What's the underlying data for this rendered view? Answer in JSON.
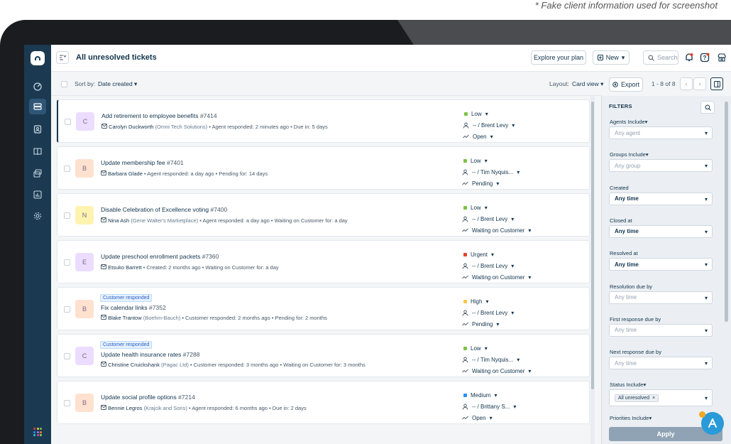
{
  "caption": "* Fake client information used for screenshot",
  "header": {
    "title": "All unresolved tickets",
    "explore_label": "Explore your plan",
    "new_label": "New",
    "search_placeholder": "Search"
  },
  "toolbar": {
    "sort_label": "Sort by:",
    "sort_value": "Date created",
    "layout_label": "Layout:",
    "layout_value": "Card view",
    "export_label": "Export",
    "pagination": "1 - 8 of 8"
  },
  "tickets": [
    {
      "initial": "C",
      "tag": "",
      "subject": "Add retirement to employee benefits",
      "number": "#7414",
      "requester": "Carolyn Duckworth",
      "company": "(Omni Tech Solutions)",
      "detail": "• Agent responded: 2 minutes ago • Due in: 5 days",
      "priority": "Low",
      "assignee": "-- / Brent Levy",
      "status": "Open"
    },
    {
      "initial": "B",
      "tag": "",
      "subject": "Update membership fee",
      "number": "#7401",
      "requester": "Barbara Glade",
      "company": "",
      "detail": "• Agent responded: a day ago • Pending for: 14 days",
      "priority": "Low",
      "assignee": "-- / Tim Nyquis...",
      "status": "Pending"
    },
    {
      "initial": "N",
      "tag": "",
      "subject": "Disable Celebration of Excellence voting",
      "number": "#7400",
      "requester": "Nina Ash",
      "company": "(Gene Walter's Marketplace)",
      "detail": "• Agent responded: a day ago • Waiting on Customer for: a day",
      "priority": "Low",
      "assignee": "-- / Brent Levy",
      "status": "Waiting on Customer"
    },
    {
      "initial": "E",
      "tag": "",
      "subject": "Update preschool enrollment packets",
      "number": "#7360",
      "requester": "Etsuko Barrett",
      "company": "",
      "detail": "• Created: 2 months ago • Waiting on Customer for: a day",
      "priority": "Urgent",
      "assignee": "-- / Brent Levy",
      "status": "Waiting on Customer"
    },
    {
      "initial": "B",
      "tag": "Customer responded",
      "subject": "Fix calendar links",
      "number": "#7352",
      "requester": "Blake Trantow",
      "company": "(Boehm-Bauch)",
      "detail": "• Customer responded: 2 months ago • Pending for: 2 months",
      "priority": "High",
      "assignee": "-- / Brent Levy",
      "status": "Pending"
    },
    {
      "initial": "C",
      "tag": "Customer responded",
      "subject": "Update health insurance rates",
      "number": "#7288",
      "requester": "Christine Cruickshank",
      "company": "(Pagac Ltd)",
      "detail": "• Customer responded: 3 months ago • Waiting on Customer for: 3 months",
      "priority": "Low",
      "assignee": "-- / Tim Nyquis...",
      "status": "Waiting on Customer"
    },
    {
      "initial": "B",
      "tag": "",
      "subject": "Update social profile options",
      "number": "#7214",
      "requester": "Bennie Legros",
      "company": "(Krajcik and Sons)",
      "detail": "• Agent responded: 6 months ago • Due in: 2 days",
      "priority": "Medium",
      "assignee": "-- / Brittany S...",
      "status": "Open"
    }
  ],
  "filters": {
    "title": "FILTERS",
    "items": [
      {
        "label": "Agents Include",
        "value": "Any agent"
      },
      {
        "label": "Groups Include",
        "value": "Any group"
      },
      {
        "label": "Created",
        "value": "Any time"
      },
      {
        "label": "Closed at",
        "value": "Any time"
      },
      {
        "label": "Resolved at",
        "value": "Any time"
      },
      {
        "label": "Resolution due by",
        "value": "Any time"
      },
      {
        "label": "First response due by",
        "value": "Any time"
      },
      {
        "label": "Next response due by",
        "value": "Any time"
      },
      {
        "label": "Status Include",
        "value": "All unresolved"
      },
      {
        "label": "Priorities Include",
        "value": ""
      }
    ],
    "apply_label": "Apply"
  },
  "colors": {
    "nav_bg": "#1b3a52",
    "avatar_C": "#ecdcff",
    "avatar_B": "#ffe1cf",
    "avatar_N": "#fff3b0",
    "avatar_E": "#ecdcff",
    "priority_low": "#7cc246",
    "priority_urgent": "#e4412d",
    "priority_high": "#f7c948",
    "priority_medium": "#2e8cf0"
  }
}
